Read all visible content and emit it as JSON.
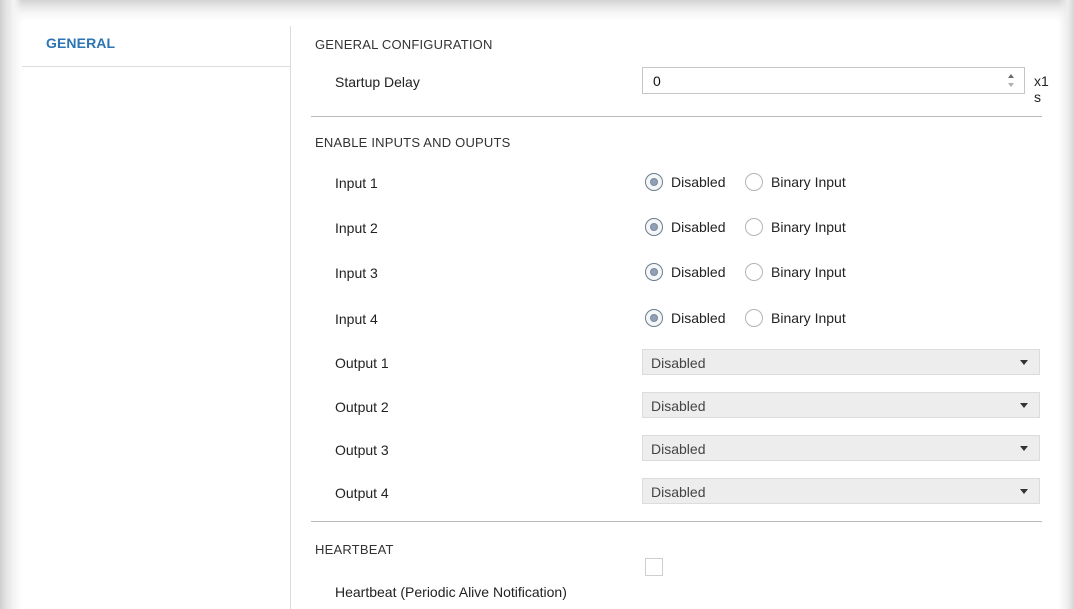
{
  "sidebar": {
    "items": [
      {
        "label": "GENERAL"
      }
    ]
  },
  "general_configuration": {
    "title": "GENERAL CONFIGURATION",
    "startup_delay": {
      "label": "Startup Delay",
      "value": "0",
      "unit": "x1 s"
    }
  },
  "inputs_outputs": {
    "title": "ENABLE INPUTS AND OUPUTS",
    "inputs": [
      {
        "label": "Input 1",
        "options": [
          "Disabled",
          "Binary Input"
        ],
        "selected": "Disabled"
      },
      {
        "label": "Input 2",
        "options": [
          "Disabled",
          "Binary Input"
        ],
        "selected": "Disabled"
      },
      {
        "label": "Input 3",
        "options": [
          "Disabled",
          "Binary Input"
        ],
        "selected": "Disabled"
      },
      {
        "label": "Input 4",
        "options": [
          "Disabled",
          "Binary Input"
        ],
        "selected": "Disabled"
      }
    ],
    "outputs": [
      {
        "label": "Output 1",
        "value": "Disabled"
      },
      {
        "label": "Output 2",
        "value": "Disabled"
      },
      {
        "label": "Output 3",
        "value": "Disabled"
      },
      {
        "label": "Output 4",
        "value": "Disabled"
      }
    ]
  },
  "heartbeat": {
    "title": "HEARTBEAT",
    "label": "Heartbeat (Periodic Alive Notification)",
    "checked": false
  },
  "colors": {
    "accent": "#2c74b3",
    "select_bg": "#ededed",
    "divider": "#b9b9b9"
  }
}
